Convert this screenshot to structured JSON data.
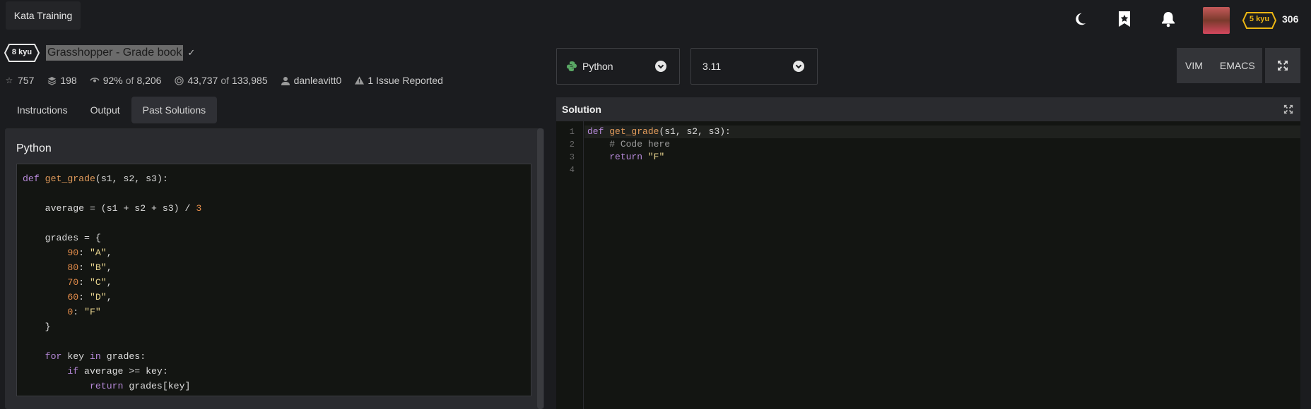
{
  "topbar": {
    "brand": "Kata Training",
    "icons": [
      "moon-icon",
      "bookmark-star-icon",
      "bell-icon"
    ],
    "rank_badge": "5 kyu",
    "rank_color": "#ecb613",
    "honor": "306"
  },
  "kata": {
    "rank": "8 kyu",
    "title": "Grasshopper - Grade book",
    "stats": {
      "stars": "757",
      "collections": "198",
      "satisfaction": "92%",
      "satisfaction_of": "of",
      "votes": "8,206",
      "completed": "43,737",
      "completed_of": "of",
      "attempts": "133,985",
      "author": "danleavitt0",
      "issues": "1 Issue Reported"
    }
  },
  "tabs": [
    {
      "label": "Instructions",
      "active": false
    },
    {
      "label": "Output",
      "active": false
    },
    {
      "label": "Past Solutions",
      "active": true
    }
  ],
  "past_solution": {
    "language": "Python"
  },
  "language_select": {
    "value": "Python"
  },
  "version_select": {
    "value": "3.11"
  },
  "editor_modes": {
    "vim": "VIM",
    "emacs": "EMACS"
  },
  "solution": {
    "header": "Solution",
    "line_numbers": [
      "1",
      "2",
      "3",
      "4"
    ]
  }
}
